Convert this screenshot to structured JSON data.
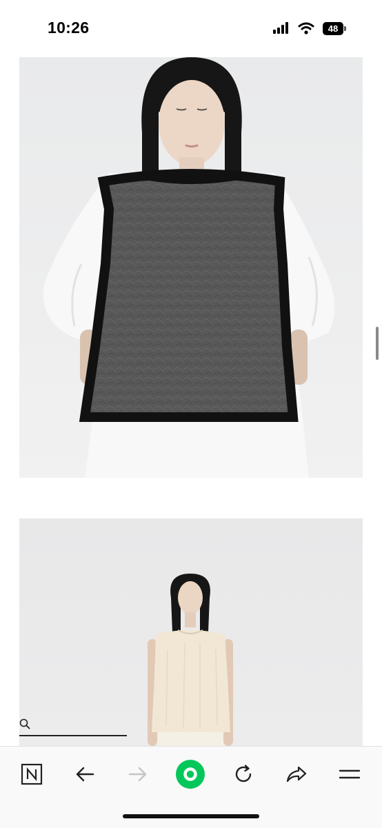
{
  "status_bar": {
    "time": "10:26",
    "battery_level": "48",
    "icons": [
      "signal-icon",
      "wifi-icon",
      "battery-icon"
    ]
  },
  "content": {
    "images": [
      "product-photo-black-sheer-vest-over-white-top",
      "product-photo-cream-sleeveless-top"
    ]
  },
  "search": {
    "icon": "search-icon"
  },
  "toolbar": {
    "items": [
      "naver-n-icon",
      "back-arrow-icon",
      "forward-arrow-icon",
      "green-home-icon",
      "reload-icon",
      "share-icon",
      "menu-icon"
    ],
    "accent_color": "#03c75a",
    "forward_disabled": true
  }
}
